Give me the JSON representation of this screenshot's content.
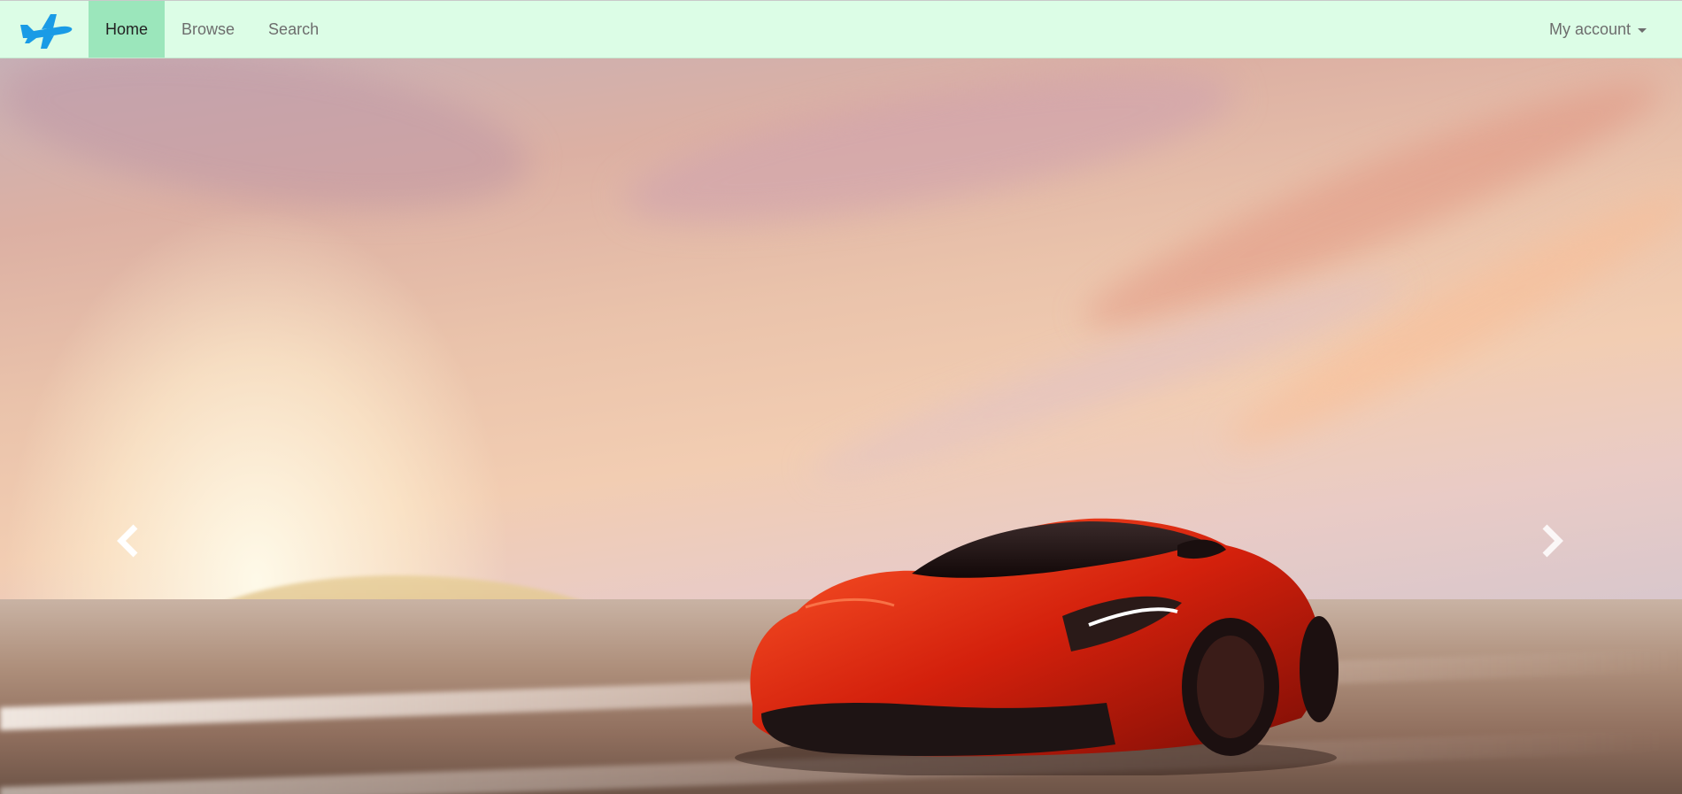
{
  "navbar": {
    "brand_icon": "airplane-icon",
    "items": [
      {
        "label": "Home",
        "active": true
      },
      {
        "label": "Browse",
        "active": false
      },
      {
        "label": "Search",
        "active": false
      }
    ],
    "account_label": "My account",
    "account_icon": "caret-down-icon"
  },
  "carousel": {
    "slide_image": "red sports car on desert track at sunset",
    "prev_icon": "chevron-left-icon",
    "next_icon": "chevron-right-icon"
  },
  "colors": {
    "navbar_bg": "#dcfde6",
    "active_tab_bg": "#9be6bb",
    "logo_blue": "#1a9be6"
  }
}
